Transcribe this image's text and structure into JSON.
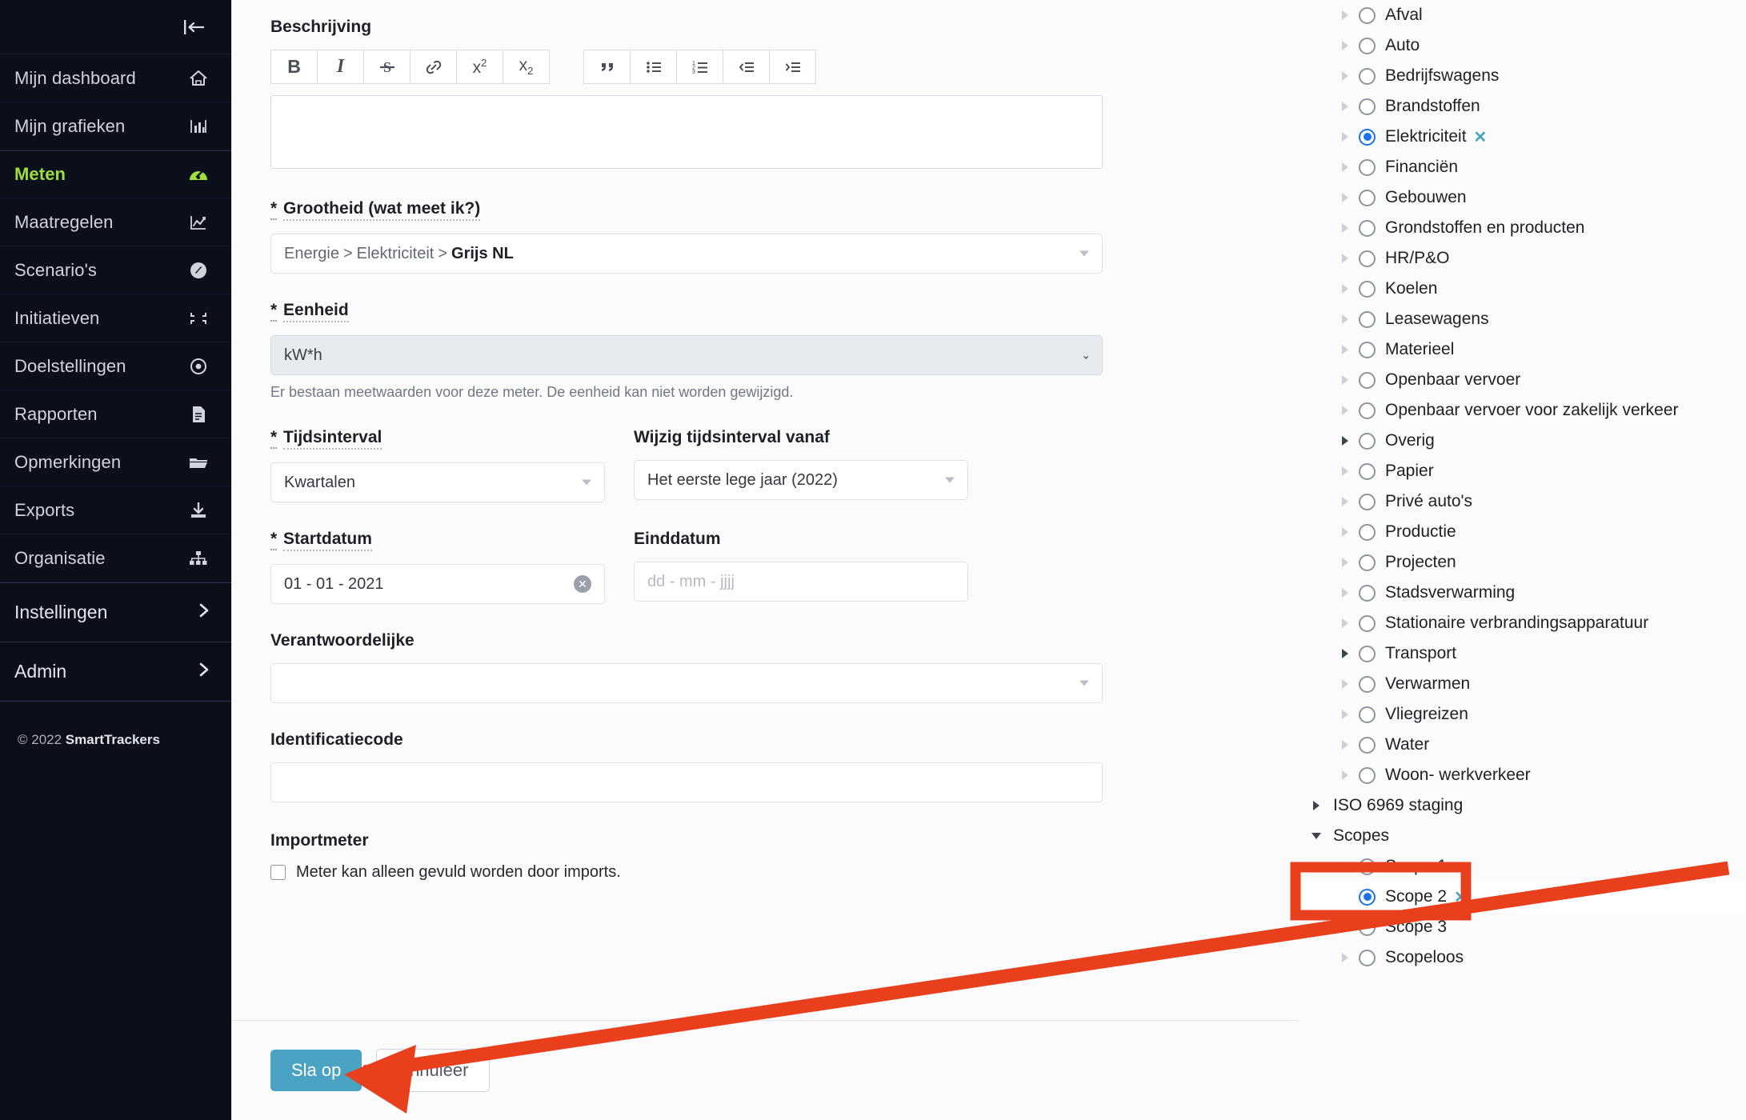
{
  "sidebar": {
    "collapse_icon": "collapse-left-icon",
    "items": [
      {
        "label": "Mijn dashboard",
        "icon": "home-icon",
        "active": false
      },
      {
        "label": "Mijn grafieken",
        "icon": "bar-chart-icon",
        "active": false
      },
      {
        "label": "Meten",
        "icon": "gauge-icon",
        "active": true
      },
      {
        "label": "Maatregelen",
        "icon": "line-chart-icon",
        "active": false
      },
      {
        "label": "Scenario's",
        "icon": "compass-icon",
        "active": false
      },
      {
        "label": "Initiatieven",
        "icon": "collapse-corners-icon",
        "active": false
      },
      {
        "label": "Doelstellingen",
        "icon": "target-icon",
        "active": false
      },
      {
        "label": "Rapporten",
        "icon": "document-icon",
        "active": false
      },
      {
        "label": "Opmerkingen",
        "icon": "folder-icon",
        "active": false
      },
      {
        "label": "Exports",
        "icon": "download-icon",
        "active": false
      },
      {
        "label": "Organisatie",
        "icon": "org-chart-icon",
        "active": false
      }
    ],
    "groups": [
      {
        "label": "Instellingen",
        "icon": "chevron-right-icon"
      },
      {
        "label": "Admin",
        "icon": "chevron-right-icon"
      }
    ],
    "footer": {
      "copyright": "© 2022 ",
      "brand": "SmartTrackers"
    }
  },
  "form": {
    "description": {
      "label": "Beschrijving",
      "value": "",
      "toolbar_group_1": [
        {
          "name": "bold-icon",
          "glyph": "B"
        },
        {
          "name": "italic-icon",
          "glyph": "I"
        },
        {
          "name": "strikethrough-icon",
          "glyph": "S"
        },
        {
          "name": "link-icon",
          "glyph": "🔗"
        },
        {
          "name": "superscript-icon",
          "glyph": "x²"
        },
        {
          "name": "subscript-icon",
          "glyph": "x₂"
        }
      ],
      "toolbar_group_2": [
        {
          "name": "blockquote-icon",
          "glyph": "❞"
        },
        {
          "name": "bullet-list-icon",
          "glyph": "•≡"
        },
        {
          "name": "numbered-list-icon",
          "glyph": "1≡"
        },
        {
          "name": "outdent-icon",
          "glyph": "‹≡"
        },
        {
          "name": "indent-icon",
          "glyph": "›≡"
        }
      ]
    },
    "grootheid": {
      "label": "Grootheid (wat meet ik?)",
      "required_marker": "*",
      "crumbs": [
        "Energie",
        "Elektriciteit"
      ],
      "leaf": "Grijs NL"
    },
    "eenheid": {
      "label": "Eenheid",
      "required_marker": "*",
      "value": "kW*h",
      "help": "Er bestaan meetwaarden voor deze meter. De eenheid kan niet worden gewijzigd.",
      "disabled": true
    },
    "tijdsinterval": {
      "label": "Tijdsinterval",
      "required_marker": "*",
      "value": "Kwartalen"
    },
    "wijzig_tijdsinterval": {
      "label": "Wijzig tijdsinterval vanaf",
      "value": "Het eerste lege jaar (2022)"
    },
    "startdatum": {
      "label": "Startdatum",
      "required_marker": "*",
      "value": "01 - 01 - 2021",
      "clear_icon": "clear-circle-icon"
    },
    "einddatum": {
      "label": "Einddatum",
      "value": "",
      "placeholder": "dd - mm - jjjj"
    },
    "verantwoordelijke": {
      "label": "Verantwoordelijke",
      "value": ""
    },
    "identificatiecode": {
      "label": "Identificatiecode",
      "value": ""
    },
    "importmeter": {
      "label": "Importmeter",
      "checkbox_label": "Meter kan alleen gevuld worden door imports.",
      "checked": false
    },
    "actions": {
      "save_label": "Sla op",
      "cancel_label": "Annuleer"
    }
  },
  "tree": {
    "nodes": [
      {
        "label": "Afval",
        "level": 1,
        "radio": true,
        "selected": false,
        "twisty": "right-faint",
        "clearable": false
      },
      {
        "label": "Auto",
        "level": 1,
        "radio": true,
        "selected": false,
        "twisty": "right-faint",
        "clearable": false
      },
      {
        "label": "Bedrijfswagens",
        "level": 1,
        "radio": true,
        "selected": false,
        "twisty": "right-faint",
        "clearable": false
      },
      {
        "label": "Brandstoffen",
        "level": 1,
        "radio": true,
        "selected": false,
        "twisty": "right-faint",
        "clearable": false
      },
      {
        "label": "Elektriciteit",
        "level": 1,
        "radio": true,
        "selected": true,
        "twisty": "right-faint",
        "clearable": true
      },
      {
        "label": "Financiën",
        "level": 1,
        "radio": true,
        "selected": false,
        "twisty": "right-faint",
        "clearable": false
      },
      {
        "label": "Gebouwen",
        "level": 1,
        "radio": true,
        "selected": false,
        "twisty": "right-faint",
        "clearable": false
      },
      {
        "label": "Grondstoffen en producten",
        "level": 1,
        "radio": true,
        "selected": false,
        "twisty": "right-faint",
        "clearable": false
      },
      {
        "label": "HR/P&O",
        "level": 1,
        "radio": true,
        "selected": false,
        "twisty": "right-faint",
        "clearable": false
      },
      {
        "label": "Koelen",
        "level": 1,
        "radio": true,
        "selected": false,
        "twisty": "right-faint",
        "clearable": false
      },
      {
        "label": "Leasewagens",
        "level": 1,
        "radio": true,
        "selected": false,
        "twisty": "right-faint",
        "clearable": false
      },
      {
        "label": "Materieel",
        "level": 1,
        "radio": true,
        "selected": false,
        "twisty": "right-faint",
        "clearable": false
      },
      {
        "label": "Openbaar vervoer",
        "level": 1,
        "radio": true,
        "selected": false,
        "twisty": "right-faint",
        "clearable": false
      },
      {
        "label": "Openbaar vervoer voor zakelijk verkeer",
        "level": 1,
        "radio": true,
        "selected": false,
        "twisty": "right-faint",
        "clearable": false
      },
      {
        "label": "Overig",
        "level": 1,
        "radio": true,
        "selected": false,
        "twisty": "right-strong",
        "clearable": false
      },
      {
        "label": "Papier",
        "level": 1,
        "radio": true,
        "selected": false,
        "twisty": "right-faint",
        "clearable": false
      },
      {
        "label": "Privé auto's",
        "level": 1,
        "radio": true,
        "selected": false,
        "twisty": "right-faint",
        "clearable": false
      },
      {
        "label": "Productie",
        "level": 1,
        "radio": true,
        "selected": false,
        "twisty": "right-faint",
        "clearable": false
      },
      {
        "label": "Projecten",
        "level": 1,
        "radio": true,
        "selected": false,
        "twisty": "right-faint",
        "clearable": false
      },
      {
        "label": "Stadsverwarming",
        "level": 1,
        "radio": true,
        "selected": false,
        "twisty": "right-faint",
        "clearable": false
      },
      {
        "label": "Stationaire verbrandingsapparatuur",
        "level": 1,
        "radio": true,
        "selected": false,
        "twisty": "right-faint",
        "clearable": false
      },
      {
        "label": "Transport",
        "level": 1,
        "radio": true,
        "selected": false,
        "twisty": "right-strong",
        "clearable": false
      },
      {
        "label": "Verwarmen",
        "level": 1,
        "radio": true,
        "selected": false,
        "twisty": "right-faint",
        "clearable": false
      },
      {
        "label": "Vliegreizen",
        "level": 1,
        "radio": true,
        "selected": false,
        "twisty": "right-faint",
        "clearable": false
      },
      {
        "label": "Water",
        "level": 1,
        "radio": true,
        "selected": false,
        "twisty": "right-faint",
        "clearable": false
      },
      {
        "label": "Woon- werkverkeer",
        "level": 1,
        "radio": true,
        "selected": false,
        "twisty": "right-faint",
        "clearable": false
      },
      {
        "label": "ISO 6969 staging",
        "level": 0,
        "radio": false,
        "selected": false,
        "twisty": "right-strong",
        "clearable": false
      },
      {
        "label": "Scopes",
        "level": 0,
        "radio": false,
        "selected": false,
        "twisty": "down",
        "clearable": false
      },
      {
        "label": "Scope 1",
        "level": 1,
        "radio": true,
        "selected": false,
        "twisty": "right-faint",
        "clearable": false
      },
      {
        "label": "Scope 2",
        "level": 1,
        "radio": true,
        "selected": true,
        "twisty": "none",
        "clearable": true,
        "highlighted": true
      },
      {
        "label": "Scope 3",
        "level": 1,
        "radio": true,
        "selected": false,
        "twisty": "right-faint",
        "clearable": false
      },
      {
        "label": "Scopeloos",
        "level": 1,
        "radio": true,
        "selected": false,
        "twisty": "right-faint",
        "clearable": false
      }
    ],
    "clear_glyph": "✕"
  },
  "annotation": {
    "color": "#e8401c",
    "highlight_box": "scope-2-highlight",
    "arrow": "arrow-pointing-to-save-button"
  }
}
